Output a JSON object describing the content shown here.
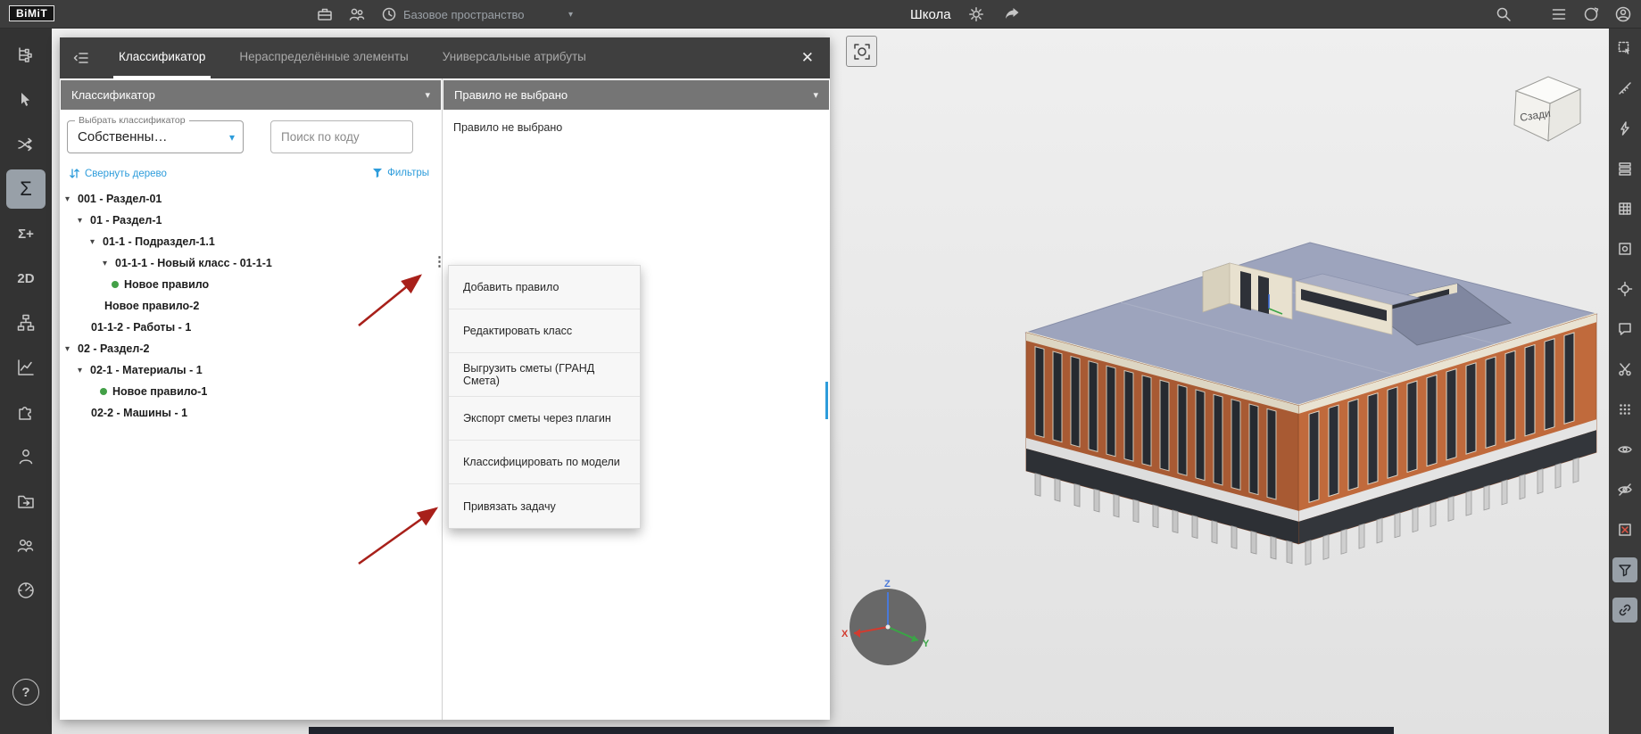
{
  "topbar": {
    "logo": "BiMiT",
    "workspace": "Базовое пространство",
    "title": "Школа"
  },
  "tabs": {
    "classifier": "Классификатор",
    "unallocated": "Нераспределённые элементы",
    "attributes": "Универсальные атрибуты",
    "close": "✕"
  },
  "classifier_panel": {
    "header": "Классификатор",
    "select_label": "Выбрать классификатор",
    "select_value": "Собственны…",
    "search_placeholder": "Поиск по коду",
    "collapse_tree": "Свернуть дерево",
    "filters": "Фильтры",
    "tree": [
      {
        "label": "001 - Раздел-01"
      },
      {
        "label": "01 - Раздел-1"
      },
      {
        "label": "01-1 - Подраздел-1.1"
      },
      {
        "label": "01-1-1 - Новый класс - 01-1-1"
      },
      {
        "label": "Новое правило"
      },
      {
        "label": "Новое правило-2"
      },
      {
        "label": "01-1-2 - Работы - 1"
      },
      {
        "label": "02 - Раздел-2"
      },
      {
        "label": "02-1 - Материалы - 1"
      },
      {
        "label": "Новое правило-1"
      },
      {
        "label": "02-2 - Машины - 1"
      }
    ]
  },
  "rule_panel": {
    "header": "Правило не выбрано",
    "empty": "Правило не выбрано"
  },
  "context_menu": {
    "items": [
      {
        "label": "Добавить правило"
      },
      {
        "label": "Редактировать класс"
      },
      {
        "label": "Выгрузить сметы (ГРАНД Смета)"
      },
      {
        "label": "Экспорт сметы через плагин"
      },
      {
        "label": "Классифицировать по модели"
      },
      {
        "label": "Привязать задачу"
      }
    ]
  },
  "viewport": {
    "nav_cube": "Сзади",
    "axis_x": "X",
    "axis_y": "Y",
    "axis_z": "Z"
  },
  "glyphs": {
    "chevron_down": "▾",
    "dots": "⋮",
    "sigma": "Σ",
    "sigma_plus": "Σ+",
    "two_d": "2D",
    "help": "?"
  },
  "colors": {
    "accent": "#2d9cdb",
    "arrow": "#a8201a",
    "dot_green": "#43a047",
    "wall": "#c06a3c",
    "roof": "#9da4bd"
  }
}
